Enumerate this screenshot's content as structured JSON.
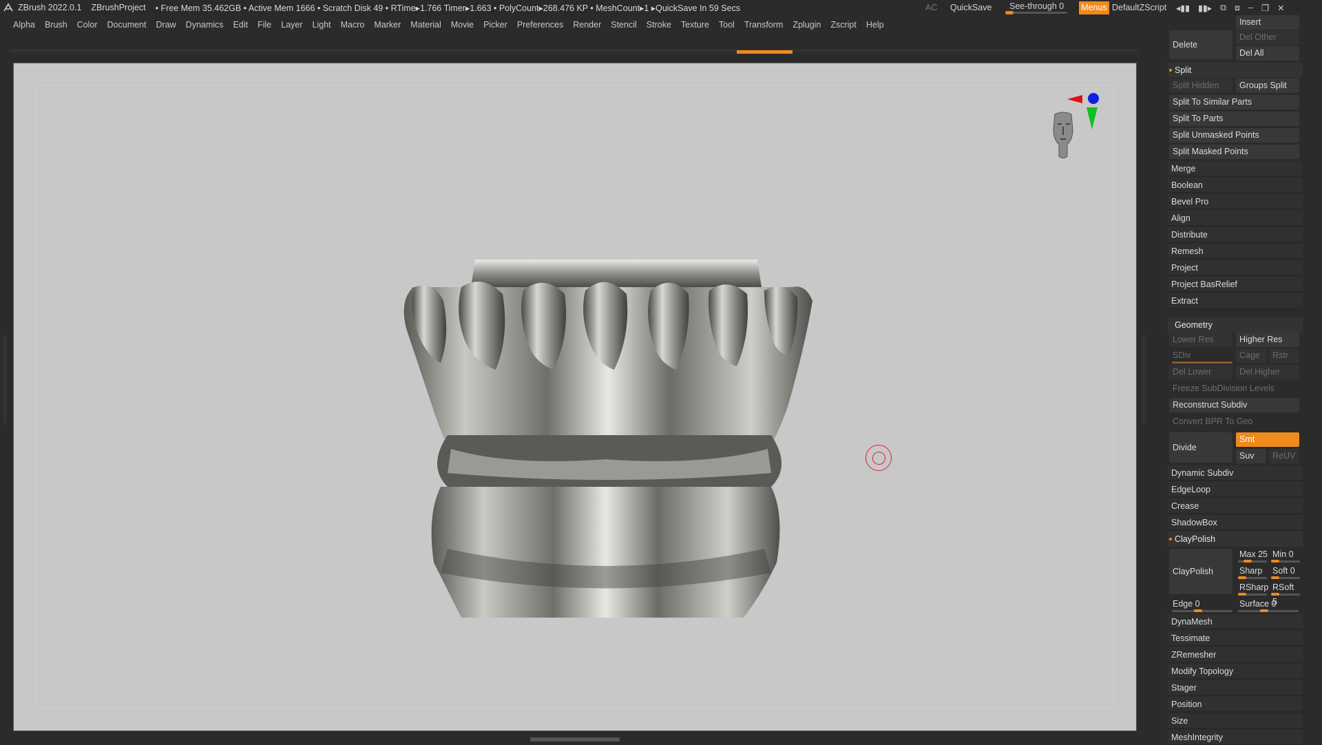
{
  "titlebar": {
    "app": "ZBrush 2022.0.1",
    "project": "ZBrushProject",
    "stats": "• Free Mem 35.462GB • Active Mem 1666 • Scratch Disk 49 • RTime▸1.766 Timer▸1.663 • PolyCount▸268.476 KP • MeshCount▸1 ▸QuickSave In 59 Secs",
    "ac": "AC",
    "quicksave": "QuickSave",
    "seethrough": "See-through 0",
    "menus": "Menus",
    "script": "DefaultZScript"
  },
  "menubar": [
    "Alpha",
    "Brush",
    "Color",
    "Document",
    "Draw",
    "Dynamics",
    "Edit",
    "File",
    "Layer",
    "Light",
    "Macro",
    "Marker",
    "Material",
    "Movie",
    "Picker",
    "Preferences",
    "Render",
    "Stencil",
    "Stroke",
    "Texture",
    "Tool",
    "Transform",
    "Zplugin",
    "Zscript",
    "Help"
  ],
  "panel": {
    "insert": "Insert",
    "delete": "Delete",
    "del_other": "Del Other",
    "del_all": "Del All",
    "split": "Split",
    "split_hidden": "Split Hidden",
    "groups_split": "Groups Split",
    "split_similar": "Split To Similar Parts",
    "split_parts": "Split To Parts",
    "split_unmasked": "Split Unmasked Points",
    "split_masked": "Split Masked Points",
    "items1": [
      "Merge",
      "Boolean",
      "Bevel Pro",
      "Align",
      "Distribute",
      "Remesh",
      "Project",
      "Project BasRelief",
      "Extract"
    ],
    "geometry": "Geometry",
    "lower_res": "Lower Res",
    "higher_res": "Higher Res",
    "sdiv": "SDiv",
    "cage": "Cage",
    "rstr": "Rstr",
    "del_lower": "Del Lower",
    "del_higher": "Del Higher",
    "freeze": "Freeze SubDivision Levels",
    "reconstruct": "Reconstruct Subdiv",
    "convert_bpr": "Convert BPR To Geo",
    "divide": "Divide",
    "smt": "Smt",
    "suv": "Suv",
    "reuv": "ReUV",
    "items2": [
      "Dynamic Subdiv",
      "EdgeLoop",
      "Crease",
      "ShadowBox"
    ],
    "claypolish_sect": "ClayPolish",
    "claypolish": "ClayPolish",
    "max": "Max 25",
    "min": "Min 0",
    "sharp": "Sharp",
    "soft": "Soft 0",
    "rsharp": "RSharp",
    "rsoft": "RSoft 5",
    "edge": "Edge 0",
    "surface": "Surface 0",
    "items3": [
      "DynaMesh",
      "Tessimate",
      "ZRemesher",
      "Modify Topology",
      "Stager",
      "Position",
      "Size",
      "MeshIntegrity"
    ]
  }
}
